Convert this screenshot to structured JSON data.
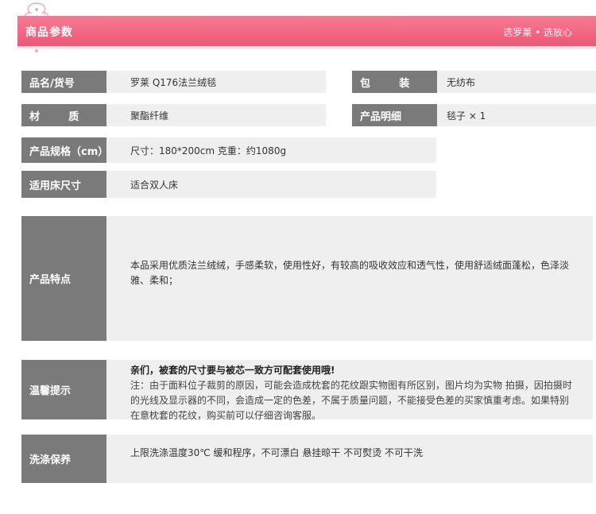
{
  "header": {
    "title": "商品参数",
    "slogan": "选罗莱 • 选放心"
  },
  "params": {
    "name_label": "品名/货号",
    "name_value": "罗莱 Q176法兰绒毯",
    "pack_label": "包        装",
    "pack_value": "无纺布",
    "material_label": "材        质",
    "material_value": "聚酯纤维",
    "detail_label": "产品明细",
    "detail_value": "毯子 × 1",
    "spec_label": "产品规格（cm）",
    "spec_value": "尺寸：180*200cm  克重：约1080g",
    "bed_label": "适用床尺寸",
    "bed_value": "适合双人床"
  },
  "features": {
    "label": "产品特点",
    "text": "本品采用优质法兰绒绒，手感柔软，使用性好，有较高的吸收效应和透气性，使用舒适绒面蓬松，色泽淡雅、柔和；"
  },
  "tips": {
    "label": "温馨提示",
    "headline": "亲们，被套的尺寸要与被芯一致方可配套使用哦!",
    "body": "注：由于面料位子裁剪的原因，可能会造成枕套的花纹跟实物图有所区别，图片均为实物 拍摄，因拍摄时的光线及显示器的不同，会造成一定的色差，不属于质量问题，不能接受色差的买家慎重考虑。如果特别在意枕套的花纹，购买前可以仔细咨询客服。"
  },
  "care": {
    "label": "洗涤保养",
    "text": "上限洗涤温度30℃ 缓和程序，不可漂白 悬挂晾干 不可熨烫 不可干洗"
  },
  "colors": {
    "header_pink": "#f26783",
    "label_gray": "#7a7a7a",
    "value_bg": "#efefef"
  }
}
